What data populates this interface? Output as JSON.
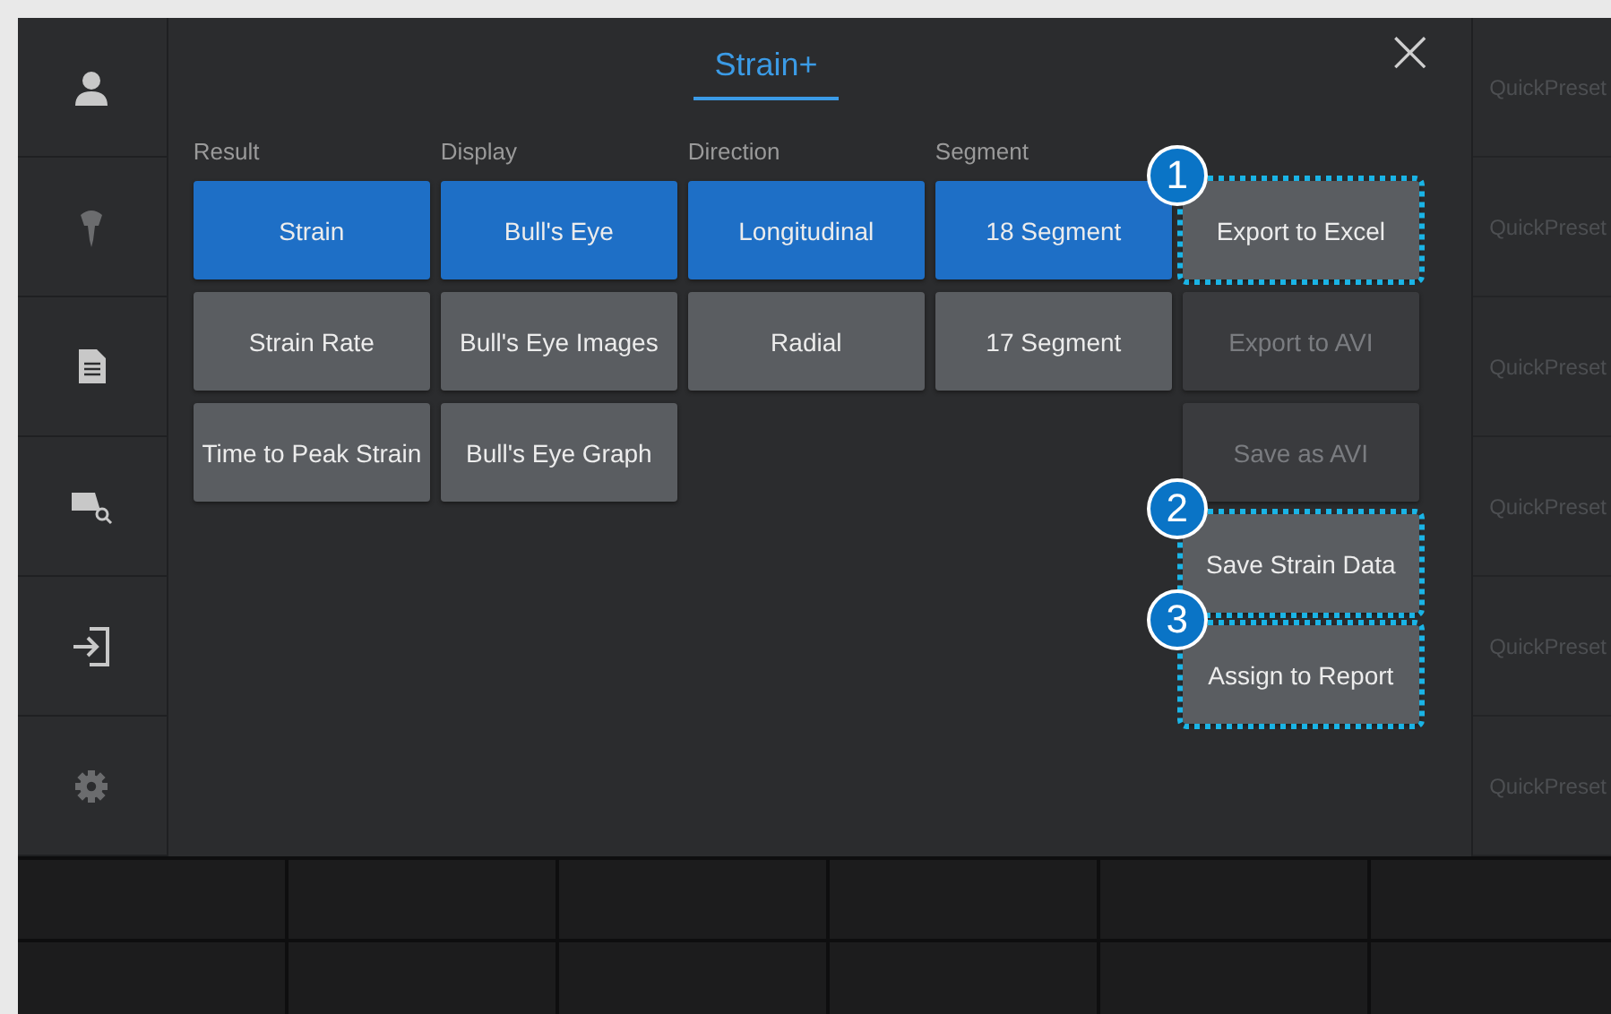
{
  "sidebar": {
    "items": [
      {
        "disabled": false
      },
      {
        "disabled": true
      },
      {
        "disabled": false
      },
      {
        "disabled": false
      },
      {
        "disabled": false
      },
      {
        "disabled": true
      }
    ]
  },
  "dialog": {
    "title": "Strain+",
    "close": "×",
    "groups": [
      {
        "label": "Result",
        "options": [
          {
            "label": "Strain",
            "selected": true
          },
          {
            "label": "Strain Rate",
            "selected": false
          },
          {
            "label": "Time to Peak Strain",
            "selected": false
          }
        ]
      },
      {
        "label": "Display",
        "options": [
          {
            "label": "Bull's Eye",
            "selected": true
          },
          {
            "label": "Bull's Eye Images",
            "selected": false
          },
          {
            "label": "Bull's Eye Graph",
            "selected": false
          }
        ]
      },
      {
        "label": "Direction",
        "options": [
          {
            "label": "Longitudinal",
            "selected": true
          },
          {
            "label": "Radial",
            "selected": false
          }
        ]
      },
      {
        "label": "Segment",
        "options": [
          {
            "label": "18 Segment",
            "selected": true
          },
          {
            "label": "17 Segment",
            "selected": false
          }
        ]
      }
    ],
    "actions": [
      {
        "label": "Export to Excel",
        "disabled": false,
        "highlighted": true,
        "callout": "1"
      },
      {
        "label": "Export to AVI",
        "disabled": true,
        "highlighted": false
      },
      {
        "label": "Save as AVI",
        "disabled": true,
        "highlighted": false
      },
      {
        "label": "Save Strain Data",
        "disabled": false,
        "highlighted": true,
        "callout": "2"
      },
      {
        "label": "Assign to Report",
        "disabled": false,
        "highlighted": true,
        "callout": "3"
      }
    ]
  },
  "quick_presets": [
    "QuickPreset",
    "QuickPreset",
    "QuickPreset",
    "QuickPreset",
    "QuickPreset",
    "QuickPreset"
  ]
}
